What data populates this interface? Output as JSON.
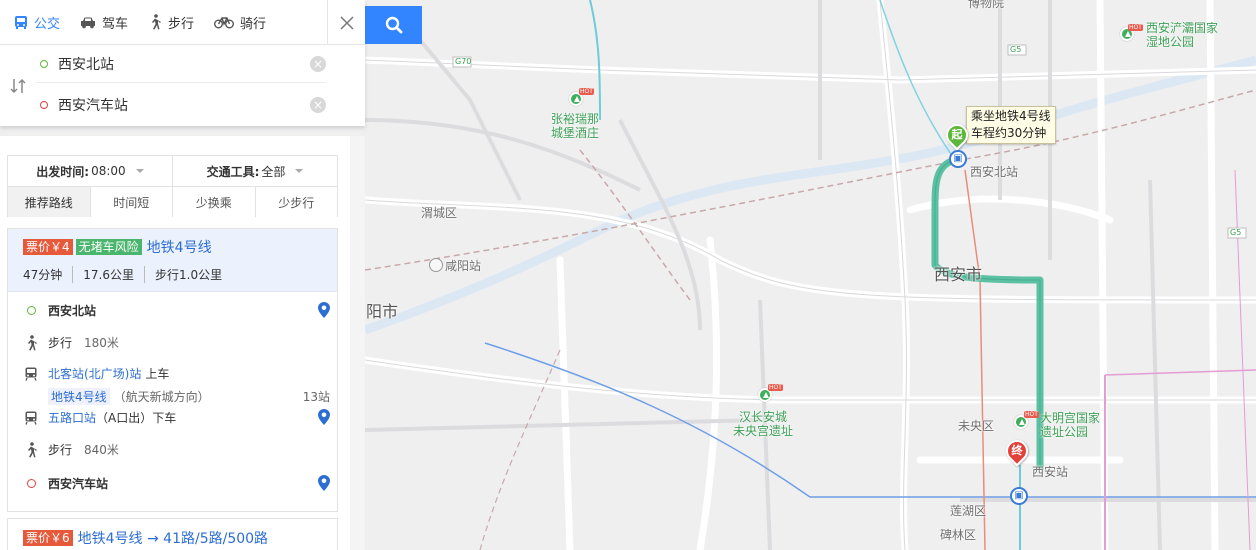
{
  "search": {
    "modes": [
      {
        "label": "公交",
        "active": true
      },
      {
        "label": "驾车",
        "active": false
      },
      {
        "label": "步行",
        "active": false
      },
      {
        "label": "骑行",
        "active": false
      }
    ],
    "origin": "西安北站",
    "destination": "西安汽车站"
  },
  "filters": {
    "depart_label": "出发时间:",
    "depart_value": "08:00",
    "transport_label": "交通工具:",
    "transport_value": "全部",
    "sort_tabs": [
      "推荐路线",
      "时间短",
      "少换乘",
      "少步行"
    ]
  },
  "route1": {
    "price_badge": "票价￥4",
    "safe_badge": "无堵车风险",
    "line": "地铁4号线",
    "duration": "47分钟",
    "distance": "17.6公里",
    "walk": "步行1.0公里",
    "steps": {
      "start": "西安北站",
      "walk1": "步行",
      "walk1_dist": "180米",
      "board_station": "北客站(北广场)站",
      "board_action": "上车",
      "line_tag": "地铁4号线",
      "direction": "（航天新城方向）",
      "stops": "13站",
      "alight_station": "五路口站",
      "alight_exit": "（A口出）",
      "alight_action": "下车",
      "walk2": "步行",
      "walk2_dist": "840米",
      "end": "西安汽车站"
    }
  },
  "route2": {
    "price_badge": "票价￥6",
    "line": "地铁4号线 → 41路/5路/500路"
  },
  "map": {
    "tooltip_line1": "乘坐地铁4号线",
    "tooltip_line2": "车程约30分钟",
    "start_pin": "起",
    "end_pin": "终",
    "labels": {
      "museum": "博物院",
      "chanba": "西安浐灞国家\n湿地公园",
      "zhangyu": "张裕瑞那\n城堡酒庄",
      "weicheng": "渭城区",
      "xianyang_station": "咸阳站",
      "xianyang_city": "阳市",
      "xian_north": "西安北站",
      "xian_city": "西安市",
      "hanchangan": "汉长安城\n未央宫遗址",
      "weiyang": "未央区",
      "daming": "大明宫国家\n遗址公园",
      "xian_station": "西安站",
      "lianhu": "莲湖区",
      "beilin": "碑林区",
      "g70": "G70",
      "g5": "G5",
      "g5b": "G5"
    }
  },
  "colors": {
    "accent": "#3385ff",
    "route": "#5cc0a2",
    "start": "#5bb73a",
    "end": "#e3423b"
  }
}
